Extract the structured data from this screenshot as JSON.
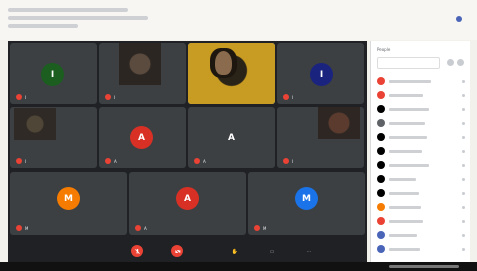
{
  "window": {
    "title": "",
    "panel_title": "People"
  },
  "grid": {
    "tiles": [
      {
        "kind": "avatar",
        "letter": "I",
        "color": "#1b5e20",
        "name": "I"
      },
      {
        "kind": "photo",
        "letter": "",
        "color": "#000000",
        "name": "I"
      },
      {
        "kind": "photo-active",
        "letter": "",
        "color": "#000000",
        "name": ""
      },
      {
        "kind": "avatar",
        "letter": "I",
        "color": "#1a237e",
        "name": "I"
      },
      {
        "kind": "photo-small",
        "letter": "",
        "color": "#000000",
        "name": "I"
      },
      {
        "kind": "avatar",
        "letter": "A",
        "color": "#d93025",
        "name": "A"
      },
      {
        "kind": "avatar",
        "letter": "A",
        "color": "#3c4043",
        "name": "A"
      },
      {
        "kind": "photo-small-2",
        "letter": "",
        "color": "#000000",
        "name": "I"
      },
      {
        "kind": "avatar",
        "letter": "M",
        "color": "#f57c00",
        "name": "M"
      },
      {
        "kind": "avatar",
        "letter": "A",
        "color": "#d93025",
        "name": "A"
      },
      {
        "kind": "avatar",
        "letter": "M",
        "color": "#1a73e8",
        "name": "M"
      }
    ]
  },
  "controls": {
    "time": "",
    "mic_icon": "mic-off-icon",
    "cam_icon": "video-off-icon"
  },
  "panel": {
    "search_placeholder": "",
    "people": [
      {
        "color": "#ea4335"
      },
      {
        "color": "#ea4335"
      },
      {
        "color": "#000000"
      },
      {
        "color": "#5f6368"
      },
      {
        "color": "#000000"
      },
      {
        "color": "#000000"
      },
      {
        "color": "#000000"
      },
      {
        "color": "#000000"
      },
      {
        "color": "#f57c00"
      },
      {
        "color": "#ea4335"
      },
      {
        "color": "#4a64b8"
      },
      {
        "color": "#4a64b8"
      }
    ]
  },
  "taskbar": {
    "label": ""
  }
}
